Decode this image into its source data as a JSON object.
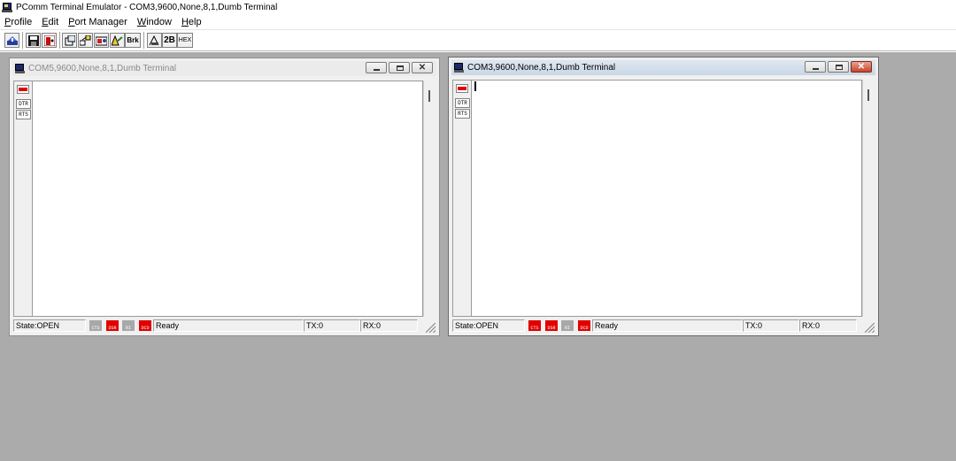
{
  "app": {
    "title": "PComm Terminal Emulator - COM3,9600,None,8,1,Dumb Terminal"
  },
  "menu": {
    "items": [
      {
        "underline": "P",
        "rest": "rofile"
      },
      {
        "underline": "E",
        "rest": "dit"
      },
      {
        "underline": "P",
        "rest": "ort Manager"
      },
      {
        "underline": "W",
        "rest": "indow"
      },
      {
        "underline": "H",
        "rest": "elp"
      }
    ]
  },
  "toolbar": {
    "break_label": "Brk",
    "twob_label": "2B",
    "hex_label": "HEX"
  },
  "windows": [
    {
      "title": "COM5,9600,None,8,1,Dumb Terminal",
      "active": false,
      "side": {
        "dtr": "DTR",
        "rts": "RTS"
      },
      "status": {
        "state": "State:OPEN",
        "signals": [
          {
            "label": "CTS",
            "on": false
          },
          {
            "label": "DSR",
            "on": true
          },
          {
            "label": "RI",
            "on": false
          },
          {
            "label": "DCD",
            "on": true
          }
        ],
        "message": "Ready",
        "tx": "TX:0",
        "rx": "RX:0"
      }
    },
    {
      "title": "COM3,9600,None,8,1,Dumb Terminal",
      "active": true,
      "side": {
        "dtr": "DTR",
        "rts": "RTS"
      },
      "status": {
        "state": "State:OPEN",
        "signals": [
          {
            "label": "CTS",
            "on": true
          },
          {
            "label": "DSR",
            "on": true
          },
          {
            "label": "RI",
            "on": false
          },
          {
            "label": "DCD",
            "on": true
          }
        ],
        "message": "Ready",
        "tx": "TX:0",
        "rx": "RX:0"
      }
    }
  ],
  "colors": {
    "mdi_background": "#ababab",
    "signal_on": "#e00000",
    "signal_off": "#a8a8a8"
  }
}
